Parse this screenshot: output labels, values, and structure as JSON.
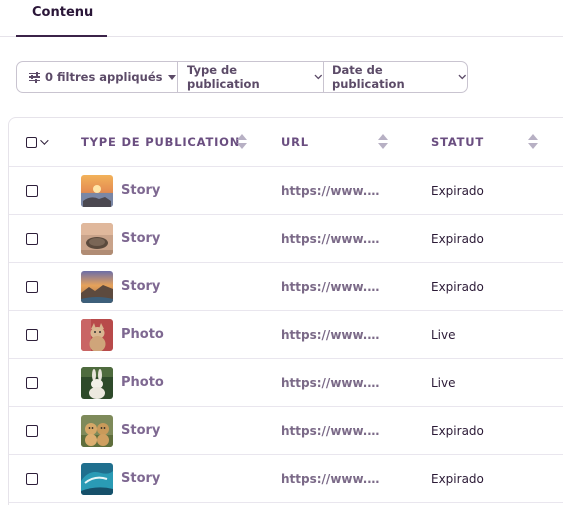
{
  "tabs": [
    {
      "label": "Contenu",
      "active": true
    }
  ],
  "filters": {
    "applied_label": "0 filtres appliqués",
    "type_label": "Type de publication",
    "date_label": "Date de publication"
  },
  "table": {
    "columns": [
      "TYPE DE PUBLICATION",
      "URL",
      "STATUT"
    ],
    "rows": [
      {
        "thumb": "sunset-beach-thumbnail",
        "type": "Story",
        "url": "https://www.i…",
        "status": "Expirado"
      },
      {
        "thumb": "turtle-beach-thumbnail",
        "type": "Story",
        "url": "https://www.i…",
        "status": "Expirado"
      },
      {
        "thumb": "coastal-cliff-thumbnail",
        "type": "Story",
        "url": "https://www.i…",
        "status": "Expirado"
      },
      {
        "thumb": "kitten-thumbnail",
        "type": "Photo",
        "url": "https://www.i…",
        "status": "Live"
      },
      {
        "thumb": "rabbit-thumbnail",
        "type": "Photo",
        "url": "https://www.i…",
        "status": "Live"
      },
      {
        "thumb": "puppies-thumbnail",
        "type": "Story",
        "url": "https://www.i…",
        "status": "Expirado"
      },
      {
        "thumb": "ocean-wave-thumbnail",
        "type": "Story",
        "url": "https://www.i…",
        "status": "Expirado"
      }
    ]
  },
  "colors": {
    "accent": "#3b2348",
    "header_text": "#6a4e80",
    "link_text": "#7e6891",
    "sort_icon": "#b7b0c4"
  }
}
